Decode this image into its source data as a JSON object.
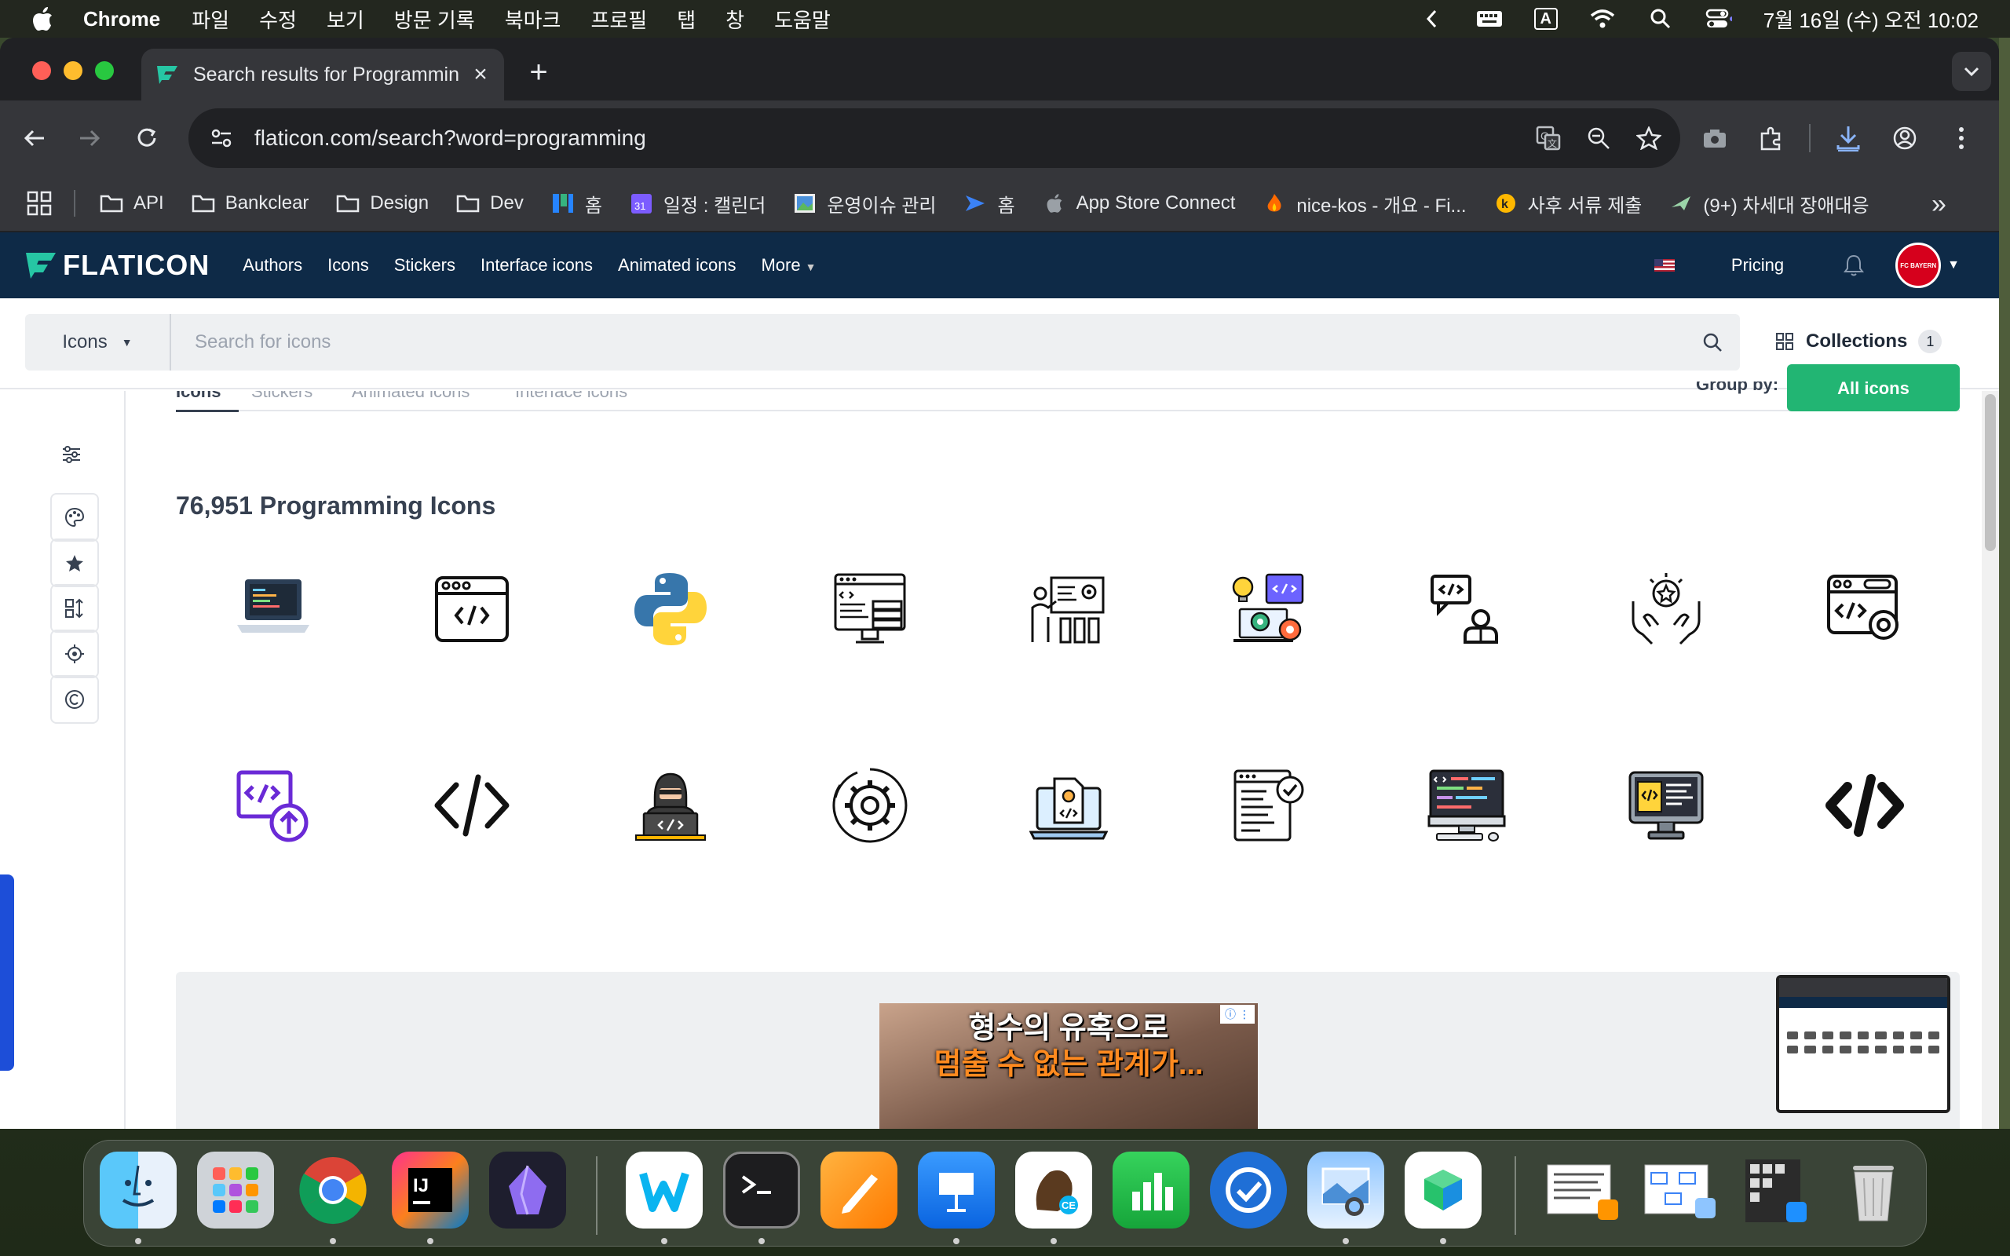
{
  "menubar": {
    "app_name": "Chrome",
    "menus": [
      "파일",
      "수정",
      "보기",
      "방문 기록",
      "북마크",
      "프로필",
      "탭",
      "창",
      "도움말"
    ],
    "clock": "7월 16일 (수) 오전 10:02",
    "input_indicator": "A"
  },
  "browser": {
    "tab_title": "Search results for Programming",
    "url": "flaticon.com/search?word=programming",
    "bookmarks": [
      {
        "label": "API",
        "icon": "folder-icon"
      },
      {
        "label": "Bankclear",
        "icon": "folder-icon"
      },
      {
        "label": "Design",
        "icon": "folder-icon"
      },
      {
        "label": "Dev",
        "icon": "folder-icon"
      },
      {
        "label": "홈",
        "icon": "board-icon"
      },
      {
        "label": "일정 : 캘린더",
        "icon": "calendar-icon"
      },
      {
        "label": "운영이슈 관리",
        "icon": "photo-icon"
      },
      {
        "label": "홈",
        "icon": "arrow-icon"
      },
      {
        "label": "App Store Connect",
        "icon": "apple-icon"
      },
      {
        "label": "nice-kos - 개요 - Fi...",
        "icon": "flame-icon"
      },
      {
        "label": "사후 서류 제출",
        "icon": "k-badge-icon"
      },
      {
        "label": "(9+) 차세대 장애대응",
        "icon": "plane-icon"
      }
    ]
  },
  "flaticon": {
    "logo": "FLATICON",
    "nav": [
      "Authors",
      "Icons",
      "Stickers",
      "Interface icons",
      "Animated icons",
      "More"
    ],
    "pricing": "Pricing",
    "avatar_text": "FC BAYERN",
    "search": {
      "type": "Icons",
      "placeholder": "Search for icons"
    },
    "collections": {
      "label": "Collections",
      "count": "1"
    },
    "filter_tabs": [
      "Icons",
      "Stickers",
      "Animated icons",
      "Interface icons"
    ],
    "group_by": "Group by:",
    "all_icons": "All icons",
    "results_title": "76,951 Programming Icons",
    "results": [
      {
        "name": "laptop-code-icon"
      },
      {
        "name": "browser-code-icon"
      },
      {
        "name": "python-icon"
      },
      {
        "name": "server-code-icon"
      },
      {
        "name": "presentation-gear-icon"
      },
      {
        "name": "idea-laptop-gear-icon"
      },
      {
        "name": "developer-chat-icon"
      },
      {
        "name": "award-hands-icon"
      },
      {
        "name": "browser-settings-icon"
      },
      {
        "name": "code-upload-icon"
      },
      {
        "name": "code-tag-outline-icon"
      },
      {
        "name": "hacker-laptop-icon"
      },
      {
        "name": "gear-circle-icon"
      },
      {
        "name": "laptop-document-icon"
      },
      {
        "name": "document-check-icon"
      },
      {
        "name": "desktop-code-icon"
      },
      {
        "name": "monitor-code-icon"
      },
      {
        "name": "code-tag-bold-icon"
      }
    ],
    "ad": {
      "line1": "형수의 유혹으로",
      "line2": "멈출 수 없는 관계가..."
    }
  },
  "dock": {
    "apps": [
      "finder",
      "launchpad",
      "chrome",
      "intellij",
      "obsidian",
      "naver-whale",
      "terminal",
      "pages",
      "keynote",
      "tableplus",
      "numbers",
      "sync",
      "preview",
      "naver-box"
    ]
  }
}
